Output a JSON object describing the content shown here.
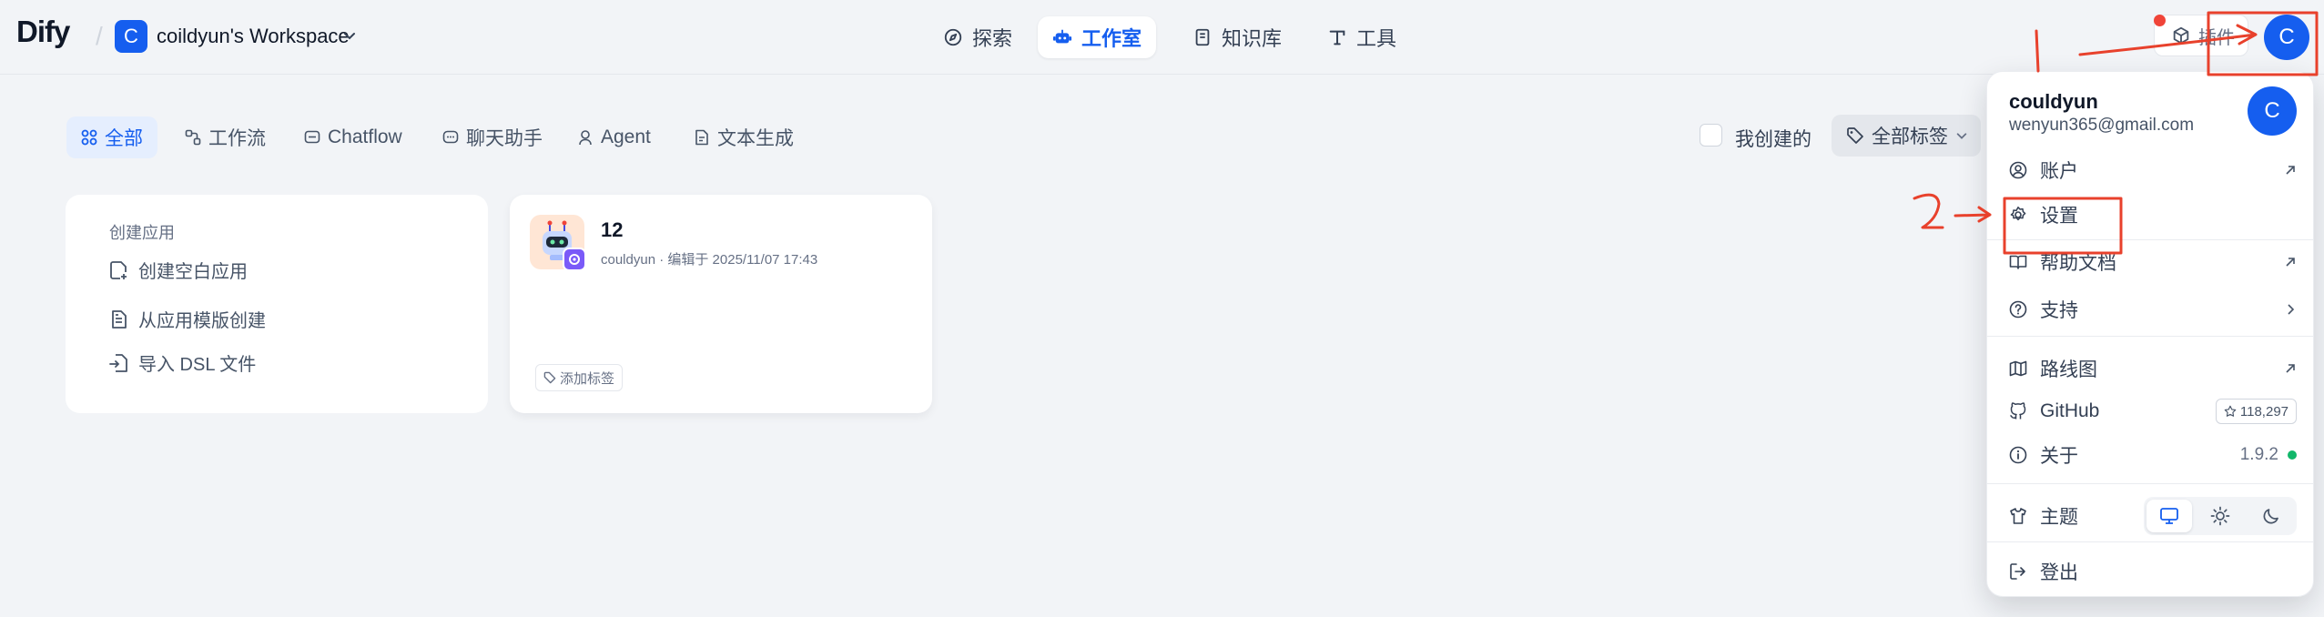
{
  "header": {
    "logo": "Dify",
    "workspace_initial": "C",
    "workspace_name": "coildyun's Workspace",
    "nav": [
      {
        "label": "探索",
        "icon": "compass-icon"
      },
      {
        "label": "工作室",
        "icon": "robot-icon",
        "active": true
      },
      {
        "label": "知识库",
        "icon": "book-icon"
      },
      {
        "label": "工具",
        "icon": "tool-icon"
      }
    ],
    "plugins_label": "插件",
    "user_initial": "C"
  },
  "filters": {
    "tabs": [
      {
        "label": "全部",
        "active": true
      },
      {
        "label": "工作流"
      },
      {
        "label": "Chatflow"
      },
      {
        "label": "聊天助手"
      },
      {
        "label": "Agent"
      },
      {
        "label": "文本生成"
      }
    ],
    "created_by_me_label": "我创建的",
    "all_tags_label": "全部标签"
  },
  "create_card": {
    "title": "创建应用",
    "items": [
      "创建空白应用",
      "从应用模版创建",
      "导入 DSL 文件"
    ]
  },
  "app_card": {
    "name": "12",
    "meta": "couldyun · 编辑于 2025/11/07 17:43",
    "add_tag_label": "添加标签"
  },
  "user_menu": {
    "name": "couldyun",
    "email": "wenyun365@gmail.com",
    "avatar_initial": "C",
    "items": {
      "account": "账户",
      "settings": "设置",
      "help": "帮助文档",
      "support": "支持",
      "roadmap": "路线图",
      "github": "GitHub",
      "github_stars": "118,297",
      "about": "关于",
      "version": "1.9.2",
      "theme": "主题",
      "logout": "登出"
    }
  },
  "colors": {
    "accent": "#155eef",
    "annotation": "#e8412c",
    "status_ok": "#12b76a"
  }
}
